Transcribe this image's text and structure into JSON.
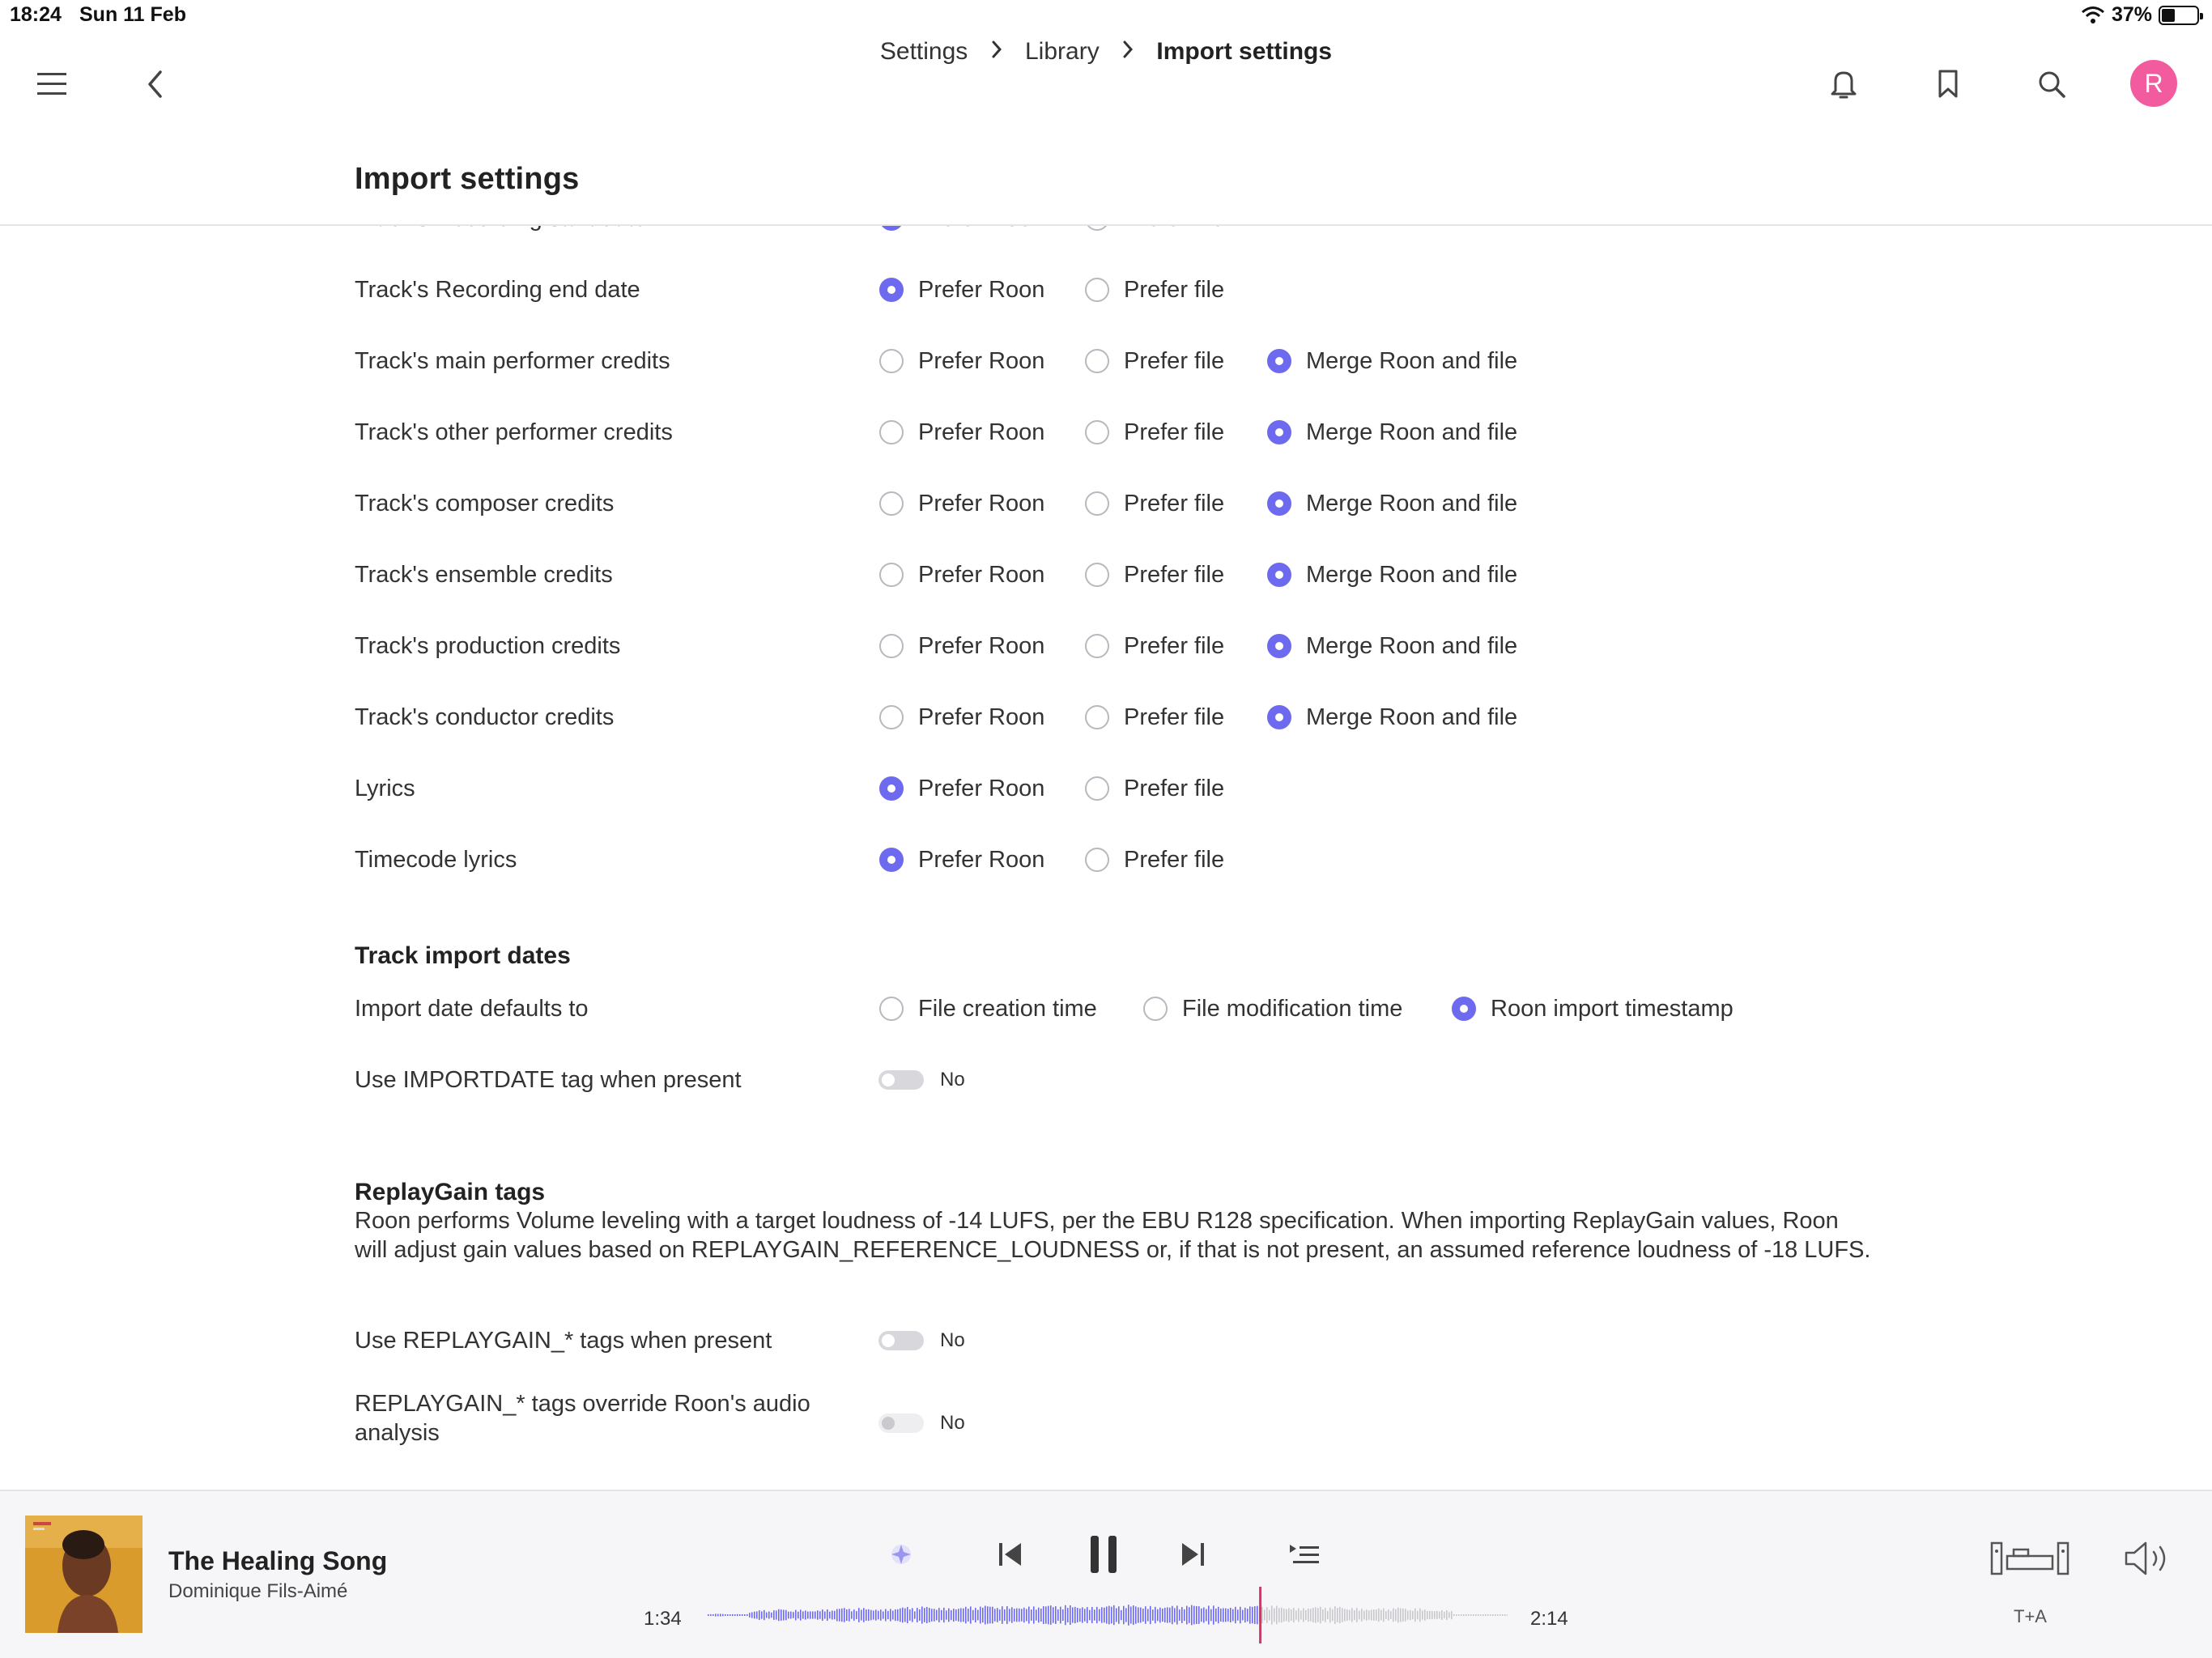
{
  "status": {
    "time": "18:24",
    "date": "Sun 11 Feb",
    "battery": "37%"
  },
  "breadcrumb": [
    "Settings",
    "Library",
    "Import settings"
  ],
  "page_title": "Import settings",
  "options": {
    "prefer_roon": "Prefer Roon",
    "prefer_file": "Prefer file",
    "merge": "Merge Roon and file"
  },
  "rows": [
    {
      "label": "Track's Recording start date",
      "selected": "roon",
      "merge": false
    },
    {
      "label": "Track's Recording end date",
      "selected": "roon",
      "merge": false
    },
    {
      "label": "Track's main performer credits",
      "selected": "merge",
      "merge": true
    },
    {
      "label": "Track's other performer credits",
      "selected": "merge",
      "merge": true
    },
    {
      "label": "Track's composer credits",
      "selected": "merge",
      "merge": true
    },
    {
      "label": "Track's ensemble credits",
      "selected": "merge",
      "merge": true
    },
    {
      "label": "Track's production credits",
      "selected": "merge",
      "merge": true
    },
    {
      "label": "Track's conductor credits",
      "selected": "merge",
      "merge": true
    },
    {
      "label": "Lyrics",
      "selected": "roon",
      "merge": false
    },
    {
      "label": "Timecode lyrics",
      "selected": "roon",
      "merge": false
    }
  ],
  "import_dates": {
    "title": "Track import dates",
    "default_label": "Import date defaults to",
    "options": [
      "File creation time",
      "File modification time",
      "Roon import timestamp"
    ],
    "selected_index": 2,
    "importdate_label": "Use IMPORTDATE tag when present",
    "importdate_value": "No"
  },
  "replaygain": {
    "title": "ReplayGain tags",
    "description": "Roon performs Volume leveling with a target loudness of -14 LUFS, per the EBU R128 specification. When importing ReplayGain values, Roon will adjust gain values based on REPLAYGAIN_REFERENCE_LOUDNESS or, if that is not present, an assumed reference loudness of -18 LUFS.",
    "use_label": "Use REPLAYGAIN_* tags when present",
    "use_value": "No",
    "override_label": "REPLAYGAIN_* tags override Roon's audio analysis",
    "override_value": "No"
  },
  "player": {
    "title": "The Healing Song",
    "artist": "Dominique Fils-Aimé",
    "elapsed": "1:34",
    "remaining": "2:14",
    "progress": 0.69,
    "zone": "T+A"
  },
  "colors": {
    "accent": "#6e6af0",
    "avatar": "#f25c9e",
    "progress": "#e0306a"
  },
  "icons": [
    "menu-icon",
    "back-icon",
    "bell-icon",
    "bookmark-icon",
    "search-icon",
    "radio-icon",
    "previous-icon",
    "pause-icon",
    "next-icon",
    "queue-icon",
    "zone-device-icon",
    "volume-icon"
  ]
}
